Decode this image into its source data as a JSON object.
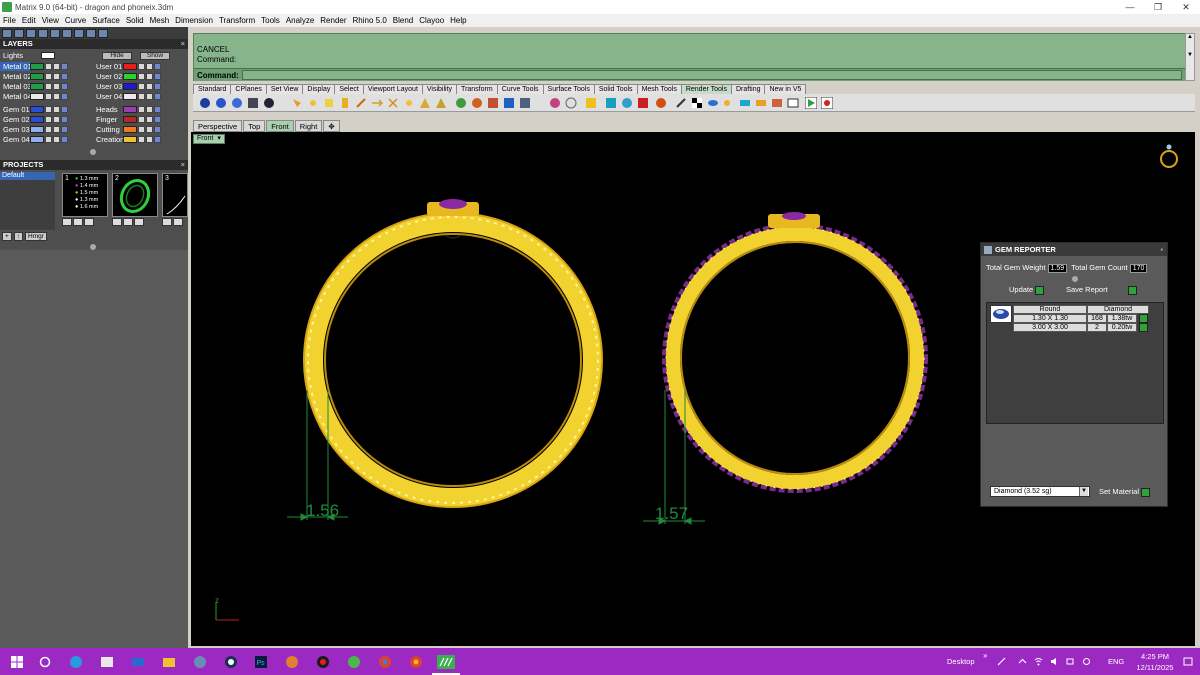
{
  "window": {
    "title": "Matrix 9.0 (64-bit) - dragon and phoneix.3dm",
    "controls": [
      "—",
      "❐",
      "✕"
    ]
  },
  "menu": [
    "File",
    "Edit",
    "View",
    "Curve",
    "Surface",
    "Solid",
    "Mesh",
    "Dimension",
    "Transform",
    "Tools",
    "Analyze",
    "Render",
    "Rhino 5.0",
    "Blend",
    "Clayoo",
    "Help"
  ],
  "layers": {
    "title": "LAYERS",
    "lights_label": "Lights",
    "hide_label": "Hide",
    "show_label": "Show",
    "left": [
      {
        "name": "Metal 01",
        "color": "#1f9e4a",
        "selected": true
      },
      {
        "name": "Metal 02",
        "color": "#1f9e4a"
      },
      {
        "name": "Metal 03",
        "color": "#1f9e4a"
      },
      {
        "name": "Metal 04",
        "color": "#eaeaea"
      },
      {
        "name": "Gem 01",
        "color": "#2a4fd6"
      },
      {
        "name": "Gem 02",
        "color": "#2a4fd6"
      },
      {
        "name": "Gem 03",
        "color": "#8fb0f0"
      },
      {
        "name": "Gem 04",
        "color": "#8fb0f0"
      }
    ],
    "right": [
      {
        "name": "User 01",
        "color": "#e81d1d"
      },
      {
        "name": "User 02",
        "color": "#25d62a"
      },
      {
        "name": "User 03",
        "color": "#1b1bd6"
      },
      {
        "name": "User 04",
        "color": "#eaeaea"
      },
      {
        "name": "Heads",
        "color": "#9b3fb0"
      },
      {
        "name": "Finger",
        "color": "#b52828"
      },
      {
        "name": "Cutting",
        "color": "#f07b1f"
      },
      {
        "name": "Creation",
        "color": "#f0c030"
      }
    ]
  },
  "projects": {
    "title": "PROJECTS",
    "list": [
      "Default"
    ],
    "thumbs": [
      "1",
      "2",
      "3"
    ],
    "gem_labels": [
      "1.3 mm",
      "1.4 mm",
      "1.5 mm",
      "1.3 mm",
      "1.6 mm"
    ],
    "buttons": [
      "+",
      "↑",
      "Hmgr"
    ]
  },
  "command": {
    "line1": "CANCEL",
    "line2": "Command:",
    "prompt": "Command:"
  },
  "toolbar_tabs": [
    "Standard",
    "CPlanes",
    "Set View",
    "Display",
    "Select",
    "Viewport Layout",
    "Visibility",
    "Transform",
    "Curve Tools",
    "Surface Tools",
    "Solid Tools",
    "Mesh Tools",
    "Render Tools",
    "Drafting",
    "New in V5"
  ],
  "active_toolbar_tab": "Render Tools",
  "viewport_tabs": [
    "Perspective",
    "Top",
    "Front",
    "Right",
    "✥"
  ],
  "active_viewport_tab": "Front",
  "viewport": {
    "label": "Front",
    "dim_left": "1.56",
    "dim_right": "1.57",
    "axis_label": "z"
  },
  "gem_reporter": {
    "title": "GEM REPORTER",
    "total_weight_label": "Total Gem Weight",
    "total_weight": "1.59",
    "total_count_label": "Total Gem Count",
    "total_count": "170",
    "update_label": "Update",
    "save_label": "Save Report",
    "col_shape": "Round",
    "col_material": "Diamond",
    "rows": [
      {
        "size": "1.30 X 1.30",
        "count": "168",
        "ctw": "1.38tw"
      },
      {
        "size": "3.00 X 3.00",
        "count": "2",
        "ctw": "0.20tw"
      }
    ],
    "material_select": "Diamond    (3.52 sg)",
    "set_material_label": "Set Material"
  },
  "taskbar": {
    "desktop_label": "Desktop",
    "lang": "ENG",
    "time": "4:25 PM",
    "date": "12/11/2025"
  }
}
